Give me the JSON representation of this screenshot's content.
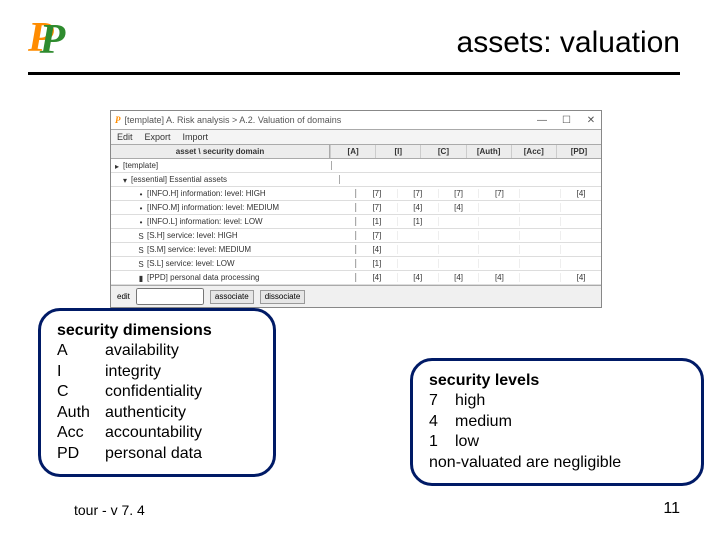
{
  "slide": {
    "title": "assets: valuation",
    "footer_left": "tour - v 7. 4",
    "page_number": "11"
  },
  "app": {
    "window_title": "[template] A. Risk analysis > A.2. Valuation of domains",
    "menu": [
      "Edit",
      "Export",
      "Import"
    ],
    "tree_header": "asset \\ security domain",
    "columns": [
      "[A]",
      "[I]",
      "[C]",
      "[Auth]",
      "[Acc]",
      "[PD]"
    ],
    "rows": [
      {
        "label": "[template]",
        "icon": "folder",
        "indent": 0,
        "vals": [
          "",
          "",
          "",
          "",
          "",
          ""
        ]
      },
      {
        "label": "[essential] Essential assets",
        "icon": "branch",
        "indent": 1,
        "vals": [
          "",
          "",
          "",
          "",
          "",
          ""
        ]
      },
      {
        "label": "[INFO.H] information: level: HIGH",
        "icon": "leaf",
        "indent": 2,
        "vals": "[7] [7] [7] [7]  [4]"
      },
      {
        "label": "[INFO.M] information: level: MEDIUM",
        "icon": "leaf",
        "indent": 2,
        "vals": "[7] [4] [4]   "
      },
      {
        "label": "[INFO.L] information: level: LOW",
        "icon": "leaf",
        "indent": 2,
        "vals": "[1] [1]    "
      },
      {
        "label": "[S.H] service: level: HIGH",
        "icon": "S",
        "indent": 2,
        "vals": "[7]     "
      },
      {
        "label": "[S.M] service: level: MEDIUM",
        "icon": "S",
        "indent": 2,
        "vals": "[4]     "
      },
      {
        "label": "[S.L] service: level: LOW",
        "icon": "S",
        "indent": 2,
        "vals": "[1]     "
      },
      {
        "label": "[PPD] personal data processing",
        "icon": "bar",
        "indent": 2,
        "vals": "[4] [4] [4] [4]  [4]"
      }
    ],
    "bottom": {
      "edit_label": "edit",
      "value_field": "",
      "assoc": "associate",
      "dissoc": "dissociate"
    }
  },
  "dimensions": {
    "heading": "security dimensions",
    "items": [
      {
        "k": "A",
        "v": "availability"
      },
      {
        "k": "I",
        "v": "integrity"
      },
      {
        "k": "C",
        "v": "confidentiality"
      },
      {
        "k": "Auth",
        "v": "authenticity"
      },
      {
        "k": "Acc",
        "v": "accountability"
      },
      {
        "k": "PD",
        "v": "personal data"
      }
    ]
  },
  "levels": {
    "heading": "security levels",
    "items": [
      {
        "k": "7",
        "v": "high"
      },
      {
        "k": "4",
        "v": "medium"
      },
      {
        "k": "1",
        "v": "low"
      }
    ],
    "note": "non-valuated are negligible"
  }
}
